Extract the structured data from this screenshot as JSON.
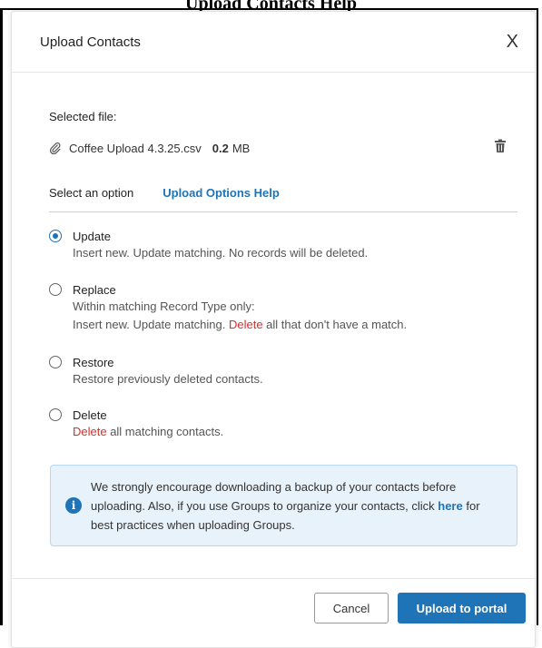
{
  "caption": "Upload Contacts Help",
  "dialog": {
    "title": "Upload Contacts",
    "close_glyph": "X"
  },
  "file": {
    "label": "Selected file:",
    "name": "Coffee Upload 4.3.25.csv",
    "size_value": "0.2",
    "size_unit": "MB",
    "attach_icon": "paperclip-icon",
    "delete_icon": "trash-icon"
  },
  "options": {
    "label": "Select an option",
    "help_link": "Upload Options Help",
    "selected": "Update",
    "items": [
      {
        "label": "Update",
        "desc1": "Insert new. Update matching. No records will be deleted."
      },
      {
        "label": "Replace",
        "desc1": "Within matching Record Type only:",
        "desc2_pre": "Insert new. Update matching. ",
        "desc2_red": "Delete",
        "desc2_post": " all that don't have a match."
      },
      {
        "label": "Restore",
        "desc1": "Restore previously deleted contacts."
      },
      {
        "label": "Delete",
        "desc_red": "Delete",
        "desc_post": " all matching contacts."
      }
    ]
  },
  "info": {
    "icon": "info-icon",
    "text_pre": "We strongly encourage downloading a backup of your contacts before uploading. Also, if you use Groups to organize your contacts, click ",
    "link": "here",
    "text_post": " for best practices when uploading Groups."
  },
  "footer": {
    "cancel": "Cancel",
    "upload": "Upload to portal"
  },
  "colors": {
    "accent": "#1f73b7",
    "danger": "#d0312d",
    "info_bg": "#e8f2fb"
  }
}
